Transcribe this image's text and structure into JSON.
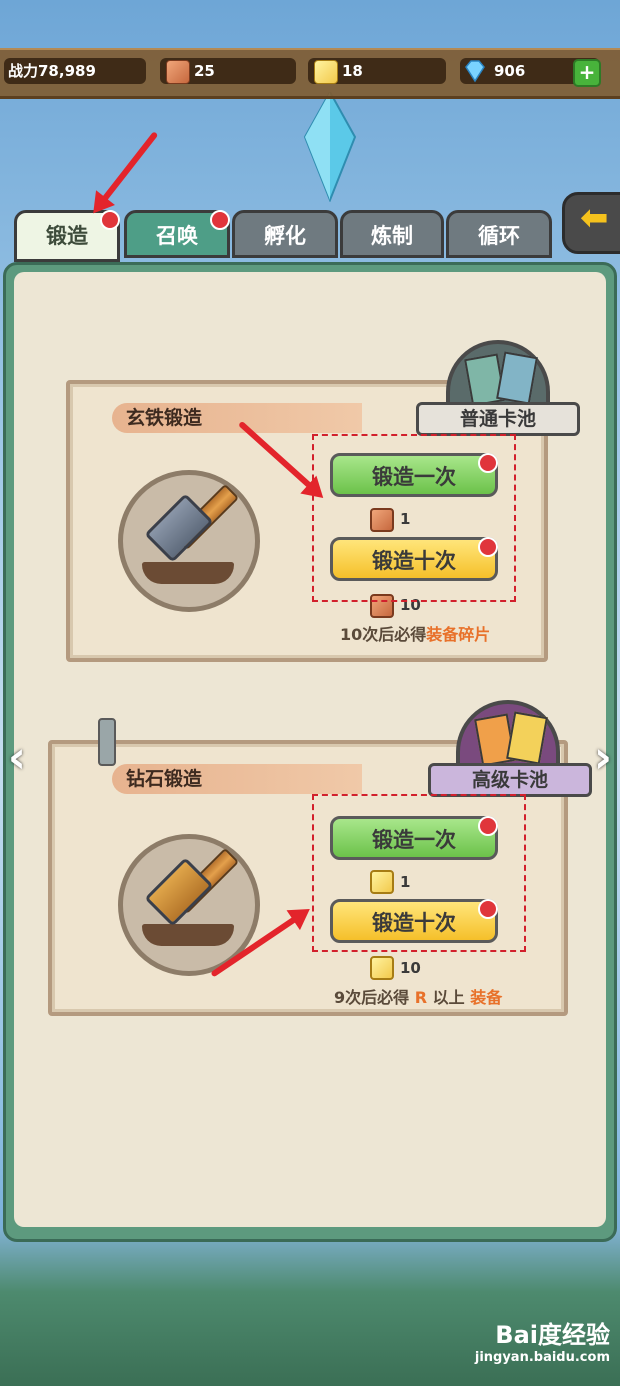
{
  "resources": {
    "power": "战力78,989",
    "copper": "25",
    "gold": "18",
    "diamond": "906",
    "plus_icon": "plus-icon"
  },
  "tabs": [
    {
      "label": "锻造",
      "active": true,
      "badge": true
    },
    {
      "label": "召唤",
      "active": false,
      "badge": true
    },
    {
      "label": "孵化",
      "active": false,
      "badge": false
    },
    {
      "label": "炼制",
      "active": false,
      "badge": false
    },
    {
      "label": "循环",
      "active": false,
      "badge": false
    }
  ],
  "cards": [
    {
      "title": "玄铁锻造",
      "pool": "普通卡池",
      "btn_once": "锻造一次",
      "btn_ten": "锻造十次",
      "cost_once": "1",
      "cost_ten": "10",
      "note_prefix": "10次后必得",
      "note_highlight": "装备碎片",
      "note_suffix": ""
    },
    {
      "title": "钻石锻造",
      "pool": "高级卡池",
      "btn_once": "锻造一次",
      "btn_ten": "锻造十次",
      "cost_once": "1",
      "cost_ten": "10",
      "note_prefix": "9次后必得",
      "note_highlight": "R",
      "note_suffix": "以上",
      "note_highlight2": "装备"
    }
  ],
  "watermark": {
    "line1": "Bai度经验",
    "line2": "jingyan.baidu.com"
  },
  "colors": {
    "accent_red": "#e3242b",
    "tab_active": "#eef5e4",
    "btn_green": "#6cc24a",
    "btn_yellow": "#f5c02a",
    "highlight": "#e8712a"
  }
}
